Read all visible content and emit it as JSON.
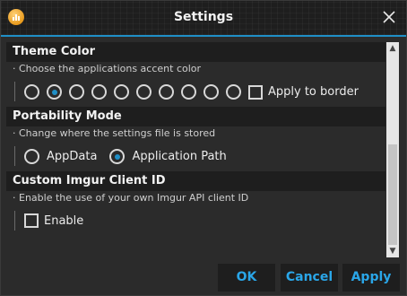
{
  "window": {
    "title": "Settings",
    "accent_color": "#1f8fc7",
    "button_text_color": "#2aa6e8"
  },
  "sections": {
    "theme": {
      "header": "Theme Color",
      "description": "· Choose the applications accent color",
      "color_options_count": 10,
      "selected_index": 1,
      "apply_to_border_label": "Apply to border",
      "apply_to_border_checked": false
    },
    "portability": {
      "header": "Portability Mode",
      "description": "· Change where the settings file is stored",
      "options": [
        "AppData",
        "Application Path"
      ],
      "selected": "Application Path"
    },
    "imgur": {
      "header": "Custom Imgur Client ID",
      "description": "· Enable the use of your own Imgur API client ID",
      "enable_label": "Enable",
      "enable_checked": false
    }
  },
  "buttons": {
    "ok": "OK",
    "cancel": "Cancel",
    "apply": "Apply"
  },
  "icons": {
    "app": "app-logo-icon",
    "close": "close-icon",
    "scroll_up": "chevron-up-icon",
    "scroll_down": "chevron-down-icon"
  }
}
